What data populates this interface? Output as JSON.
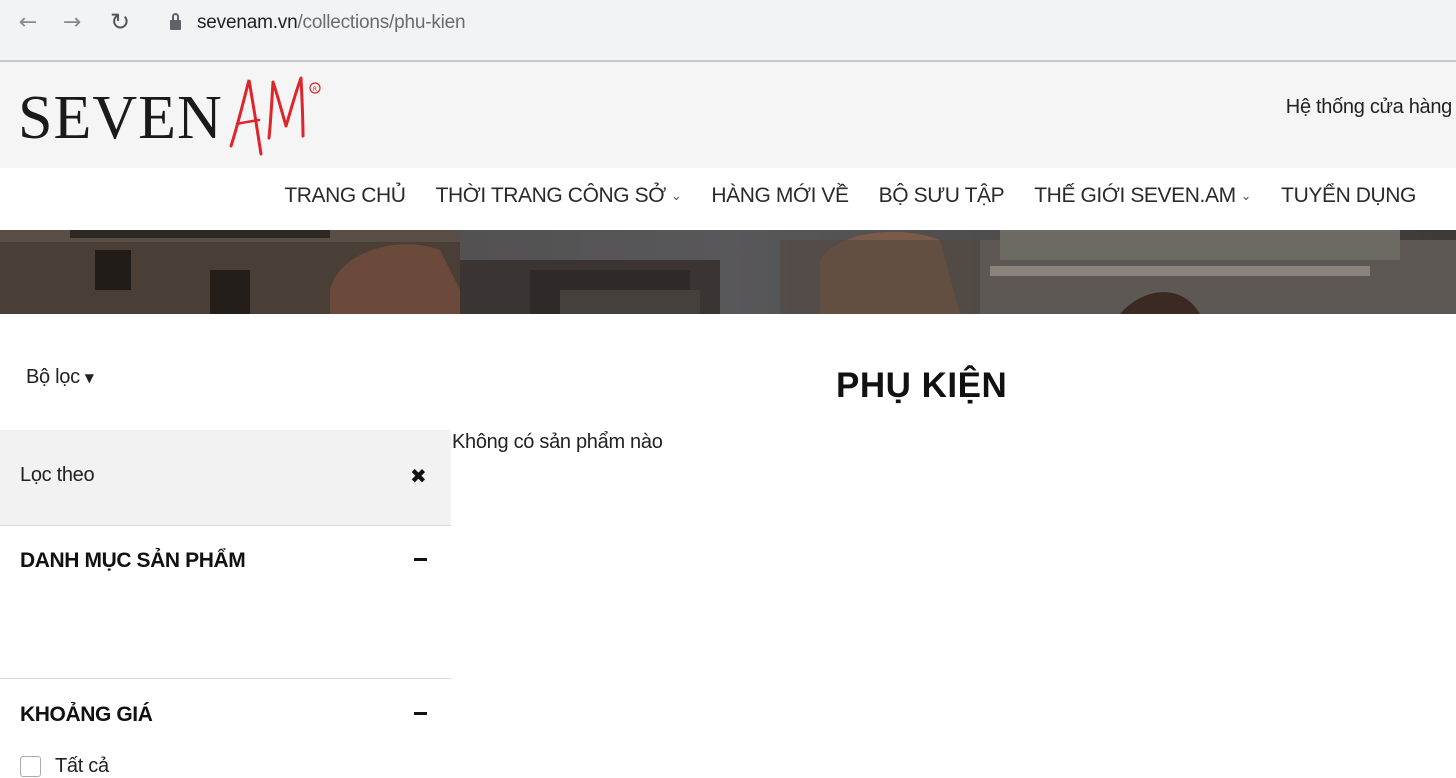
{
  "browser": {
    "url_domain": "sevenam.vn",
    "url_path": "/collections/phu-kien",
    "back_icon": "←",
    "forward_icon": "→",
    "reload_icon": "↻"
  },
  "header": {
    "logo_text": "SEVEN",
    "logo_accent_text": "AM",
    "store_link": "Hệ thống cửa hàng"
  },
  "nav": {
    "items": [
      {
        "label": "TRANG CHỦ",
        "has_dropdown": false
      },
      {
        "label": "THỜI TRANG CÔNG SỞ",
        "has_dropdown": true
      },
      {
        "label": "HÀNG MỚI VỀ",
        "has_dropdown": false
      },
      {
        "label": "BỘ SƯU TẬP",
        "has_dropdown": false
      },
      {
        "label": "THẾ GIỚI SEVEN.AM",
        "has_dropdown": true
      },
      {
        "label": "TUYỂN DỤNG",
        "has_dropdown": false
      }
    ]
  },
  "filter": {
    "toggle_label": "Bộ lọc",
    "panel_title": "Lọc theo",
    "sections": [
      {
        "title": "DANH MỤC SẢN PHẨM"
      },
      {
        "title": "KHOẢNG GIÁ",
        "options": [
          {
            "label": "Tất cả",
            "checked": false
          }
        ]
      }
    ]
  },
  "content": {
    "page_title": "PHỤ KIỆN",
    "empty_message": "Không có sản phẩm nào"
  },
  "colors": {
    "accent_red": "#e0242b",
    "header_bg": "#f5f5f5",
    "filter_head_bg": "#f2f2f2"
  }
}
